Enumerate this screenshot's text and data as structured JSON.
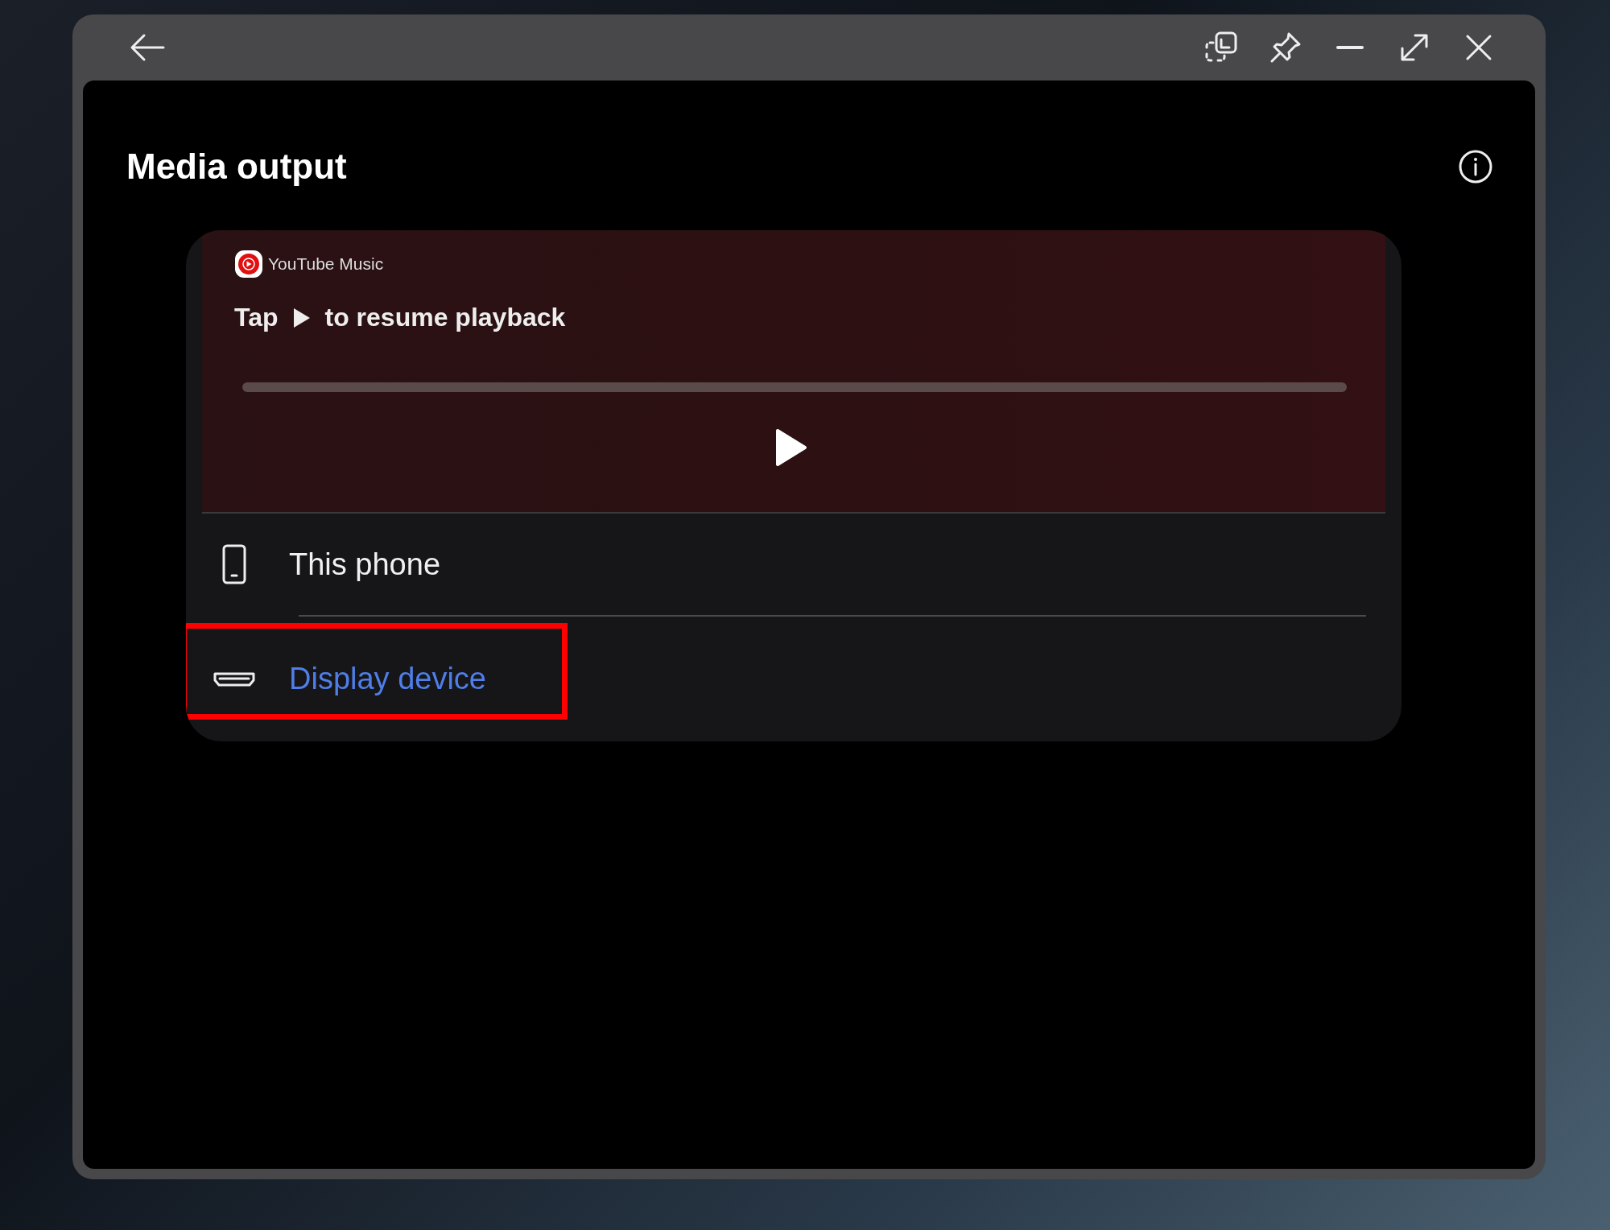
{
  "title": "Media output",
  "media": {
    "app": "YouTube Music",
    "prompt_before": "Tap",
    "prompt_after": "to resume playback"
  },
  "devices": [
    {
      "kind": "phone",
      "label": "This phone",
      "selected": false,
      "highlighted": false
    },
    {
      "kind": "display",
      "label": "Display device",
      "selected": true,
      "highlighted": true
    }
  ]
}
